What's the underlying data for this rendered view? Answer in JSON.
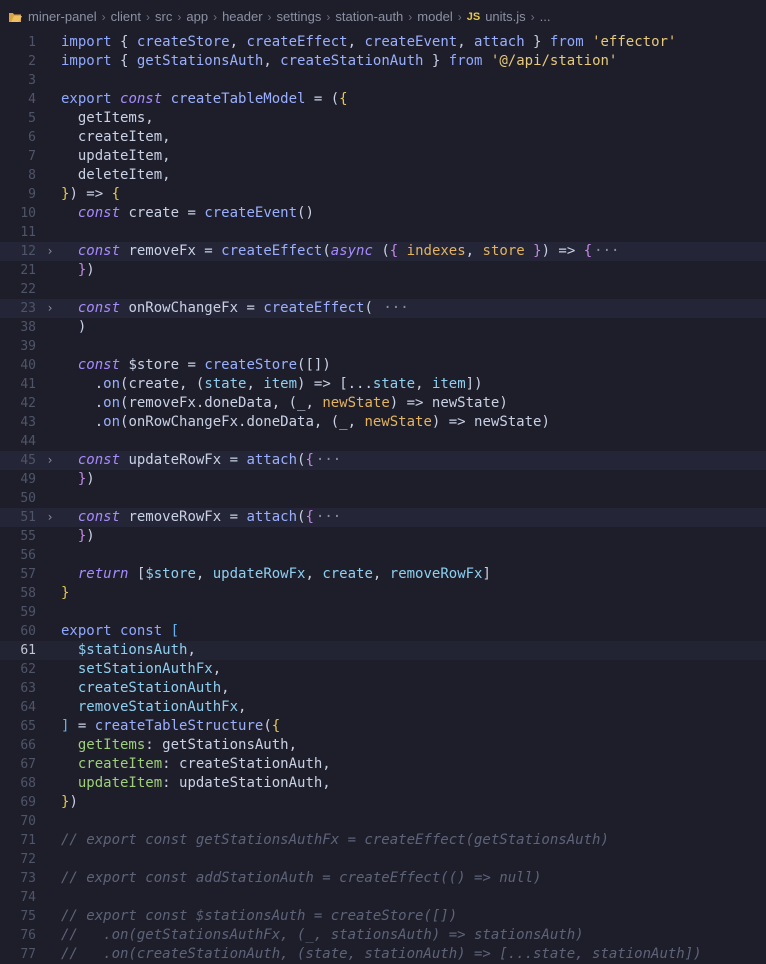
{
  "breadcrumb": {
    "items": [
      "miner-panel",
      "client",
      "src",
      "app",
      "header",
      "settings",
      "station-auth",
      "model"
    ],
    "file_badge": "JS",
    "file_name": "units.js",
    "trailing": "..."
  },
  "editor": {
    "current_line": "61",
    "lines": [
      {
        "n": "1",
        "tokens": [
          [
            "kw",
            "import "
          ],
          [
            "pun",
            "{ "
          ],
          [
            "fn",
            "createStore"
          ],
          [
            "pun",
            ", "
          ],
          [
            "fn",
            "createEffect"
          ],
          [
            "pun",
            ", "
          ],
          [
            "fn",
            "createEvent"
          ],
          [
            "pun",
            ", "
          ],
          [
            "fn",
            "attach"
          ],
          [
            "pun",
            " } "
          ],
          [
            "kw",
            "from "
          ],
          [
            "str",
            "'effector'"
          ]
        ]
      },
      {
        "n": "2",
        "tokens": [
          [
            "kw",
            "import "
          ],
          [
            "pun",
            "{ "
          ],
          [
            "fn",
            "getStationsAuth"
          ],
          [
            "pun",
            ", "
          ],
          [
            "fn",
            "createStationAuth"
          ],
          [
            "pun",
            " } "
          ],
          [
            "kw",
            "from "
          ],
          [
            "str",
            "'@/api/station'"
          ]
        ]
      },
      {
        "n": "3",
        "tokens": []
      },
      {
        "n": "4",
        "tokens": [
          [
            "kw",
            "export "
          ],
          [
            "kwi",
            "const "
          ],
          [
            "fn",
            "createTableModel"
          ],
          [
            "pun",
            " = ("
          ],
          [
            "br",
            "{"
          ]
        ]
      },
      {
        "n": "5",
        "tokens": [
          [
            "pun",
            "  "
          ],
          [
            "id",
            "getItems,"
          ]
        ]
      },
      {
        "n": "6",
        "tokens": [
          [
            "pun",
            "  "
          ],
          [
            "id",
            "createItem,"
          ]
        ]
      },
      {
        "n": "7",
        "tokens": [
          [
            "pun",
            "  "
          ],
          [
            "id",
            "updateItem,"
          ]
        ]
      },
      {
        "n": "8",
        "tokens": [
          [
            "pun",
            "  "
          ],
          [
            "id",
            "deleteItem,"
          ]
        ]
      },
      {
        "n": "9",
        "tokens": [
          [
            "br",
            "}"
          ],
          [
            "pun",
            ") => "
          ],
          [
            "br",
            "{"
          ]
        ]
      },
      {
        "n": "10",
        "tokens": [
          [
            "pun",
            "  "
          ],
          [
            "kwi",
            "const "
          ],
          [
            "id",
            "create"
          ],
          [
            "pun",
            " = "
          ],
          [
            "fn",
            "createEvent"
          ],
          [
            "pun",
            "()"
          ]
        ]
      },
      {
        "n": "11",
        "tokens": []
      },
      {
        "n": "12",
        "fold": true,
        "hl": true,
        "tokens": [
          [
            "pun",
            "  "
          ],
          [
            "kwi",
            "const "
          ],
          [
            "id",
            "removeFx"
          ],
          [
            "pun",
            " = "
          ],
          [
            "fn",
            "createEffect"
          ],
          [
            "pun",
            "("
          ],
          [
            "kwi",
            "async "
          ],
          [
            "pun",
            "("
          ],
          [
            "br2",
            "{"
          ],
          [
            "pun",
            " "
          ],
          [
            "prm",
            "indexes"
          ],
          [
            "pun",
            ", "
          ],
          [
            "prm",
            "store"
          ],
          [
            "pun",
            " "
          ],
          [
            "br2",
            "}"
          ],
          [
            "pun",
            ") => "
          ],
          [
            "br2",
            "{"
          ],
          [
            "ell",
            "···"
          ]
        ]
      },
      {
        "n": "21",
        "tokens": [
          [
            "pun",
            "  "
          ],
          [
            "br2",
            "}"
          ],
          [
            "pun",
            ")"
          ]
        ]
      },
      {
        "n": "22",
        "tokens": []
      },
      {
        "n": "23",
        "fold": true,
        "hl": true,
        "tokens": [
          [
            "pun",
            "  "
          ],
          [
            "kwi",
            "const "
          ],
          [
            "id",
            "onRowChangeFx"
          ],
          [
            "pun",
            " = "
          ],
          [
            "fn",
            "createEffect"
          ],
          [
            "pun",
            "("
          ],
          [
            "ell",
            " ···"
          ]
        ]
      },
      {
        "n": "38",
        "tokens": [
          [
            "pun",
            "  )"
          ]
        ]
      },
      {
        "n": "39",
        "tokens": []
      },
      {
        "n": "40",
        "tokens": [
          [
            "pun",
            "  "
          ],
          [
            "kwi",
            "const "
          ],
          [
            "id",
            "$store"
          ],
          [
            "pun",
            " = "
          ],
          [
            "fn",
            "createStore"
          ],
          [
            "pun",
            "([])"
          ]
        ]
      },
      {
        "n": "41",
        "tokens": [
          [
            "pun",
            "    ."
          ],
          [
            "fn",
            "on"
          ],
          [
            "pun",
            "(create, ("
          ],
          [
            "vb",
            "state"
          ],
          [
            "pun",
            ", "
          ],
          [
            "vb",
            "item"
          ],
          [
            "pun",
            ") => ["
          ],
          [
            "pun",
            "..."
          ],
          [
            "vb",
            "state"
          ],
          [
            "pun",
            ", "
          ],
          [
            "vb",
            "item"
          ],
          [
            "pun",
            "])"
          ]
        ]
      },
      {
        "n": "42",
        "tokens": [
          [
            "pun",
            "    ."
          ],
          [
            "fn",
            "on"
          ],
          [
            "pun",
            "(removeFx.doneData, (_, "
          ],
          [
            "prm",
            "newState"
          ],
          [
            "pun",
            ") => newState)"
          ]
        ]
      },
      {
        "n": "43",
        "tokens": [
          [
            "pun",
            "    ."
          ],
          [
            "fn",
            "on"
          ],
          [
            "pun",
            "(onRowChangeFx.doneData, (_, "
          ],
          [
            "prm",
            "newState"
          ],
          [
            "pun",
            ") => newState)"
          ]
        ]
      },
      {
        "n": "44",
        "tokens": []
      },
      {
        "n": "45",
        "fold": true,
        "hl": true,
        "tokens": [
          [
            "pun",
            "  "
          ],
          [
            "kwi",
            "const "
          ],
          [
            "id",
            "updateRowFx"
          ],
          [
            "pun",
            " = "
          ],
          [
            "fn",
            "attach"
          ],
          [
            "pun",
            "("
          ],
          [
            "br2",
            "{"
          ],
          [
            "ell",
            "···"
          ]
        ]
      },
      {
        "n": "49",
        "tokens": [
          [
            "pun",
            "  "
          ],
          [
            "br2",
            "}"
          ],
          [
            "pun",
            ")"
          ]
        ]
      },
      {
        "n": "50",
        "tokens": []
      },
      {
        "n": "51",
        "fold": true,
        "hl": true,
        "tokens": [
          [
            "pun",
            "  "
          ],
          [
            "kwi",
            "const "
          ],
          [
            "id",
            "removeRowFx"
          ],
          [
            "pun",
            " = "
          ],
          [
            "fn",
            "attach"
          ],
          [
            "pun",
            "("
          ],
          [
            "br2",
            "{"
          ],
          [
            "ell",
            "···"
          ]
        ]
      },
      {
        "n": "55",
        "tokens": [
          [
            "pun",
            "  "
          ],
          [
            "br2",
            "}"
          ],
          [
            "pun",
            ")"
          ]
        ]
      },
      {
        "n": "56",
        "tokens": []
      },
      {
        "n": "57",
        "tokens": [
          [
            "pun",
            "  "
          ],
          [
            "kwi",
            "return "
          ],
          [
            "pun",
            "["
          ],
          [
            "vb",
            "$store"
          ],
          [
            "pun",
            ", "
          ],
          [
            "vb",
            "updateRowFx"
          ],
          [
            "pun",
            ", "
          ],
          [
            "vb",
            "create"
          ],
          [
            "pun",
            ", "
          ],
          [
            "vb",
            "removeRowFx"
          ],
          [
            "pun",
            "]"
          ]
        ]
      },
      {
        "n": "58",
        "tokens": [
          [
            "br",
            "}"
          ]
        ]
      },
      {
        "n": "59",
        "tokens": []
      },
      {
        "n": "60",
        "tokens": [
          [
            "kw",
            "export "
          ],
          [
            "kw",
            "const "
          ],
          [
            "br3",
            "["
          ]
        ]
      },
      {
        "n": "61",
        "current": true,
        "tokens": [
          [
            "pun",
            "  "
          ],
          [
            "vb",
            "$stationsAuth"
          ],
          [
            "pun",
            ","
          ]
        ]
      },
      {
        "n": "62",
        "tokens": [
          [
            "pun",
            "  "
          ],
          [
            "vb",
            "setStationAuthFx"
          ],
          [
            "pun",
            ","
          ]
        ]
      },
      {
        "n": "63",
        "tokens": [
          [
            "pun",
            "  "
          ],
          [
            "vb",
            "createStationAuth"
          ],
          [
            "pun",
            ","
          ]
        ]
      },
      {
        "n": "64",
        "tokens": [
          [
            "pun",
            "  "
          ],
          [
            "vb",
            "removeStationAuthFx"
          ],
          [
            "pun",
            ","
          ]
        ]
      },
      {
        "n": "65",
        "tokens": [
          [
            "br3",
            "]"
          ],
          [
            "pun",
            " = "
          ],
          [
            "fn",
            "createTableStructure"
          ],
          [
            "pun",
            "("
          ],
          [
            "br",
            "{"
          ]
        ]
      },
      {
        "n": "66",
        "tokens": [
          [
            "pun",
            "  "
          ],
          [
            "prop",
            "getItems"
          ],
          [
            "pun",
            ": getStationsAuth,"
          ]
        ]
      },
      {
        "n": "67",
        "tokens": [
          [
            "pun",
            "  "
          ],
          [
            "prop",
            "createItem"
          ],
          [
            "pun",
            ": createStationAuth,"
          ]
        ]
      },
      {
        "n": "68",
        "tokens": [
          [
            "pun",
            "  "
          ],
          [
            "prop",
            "updateItem"
          ],
          [
            "pun",
            ": updateStationAuth,"
          ]
        ]
      },
      {
        "n": "69",
        "tokens": [
          [
            "br",
            "}"
          ],
          [
            "pun",
            ")"
          ]
        ]
      },
      {
        "n": "70",
        "tokens": []
      },
      {
        "n": "71",
        "tokens": [
          [
            "cmt",
            "// export const getStationsAuthFx = createEffect(getStationsAuth)"
          ]
        ]
      },
      {
        "n": "72",
        "tokens": []
      },
      {
        "n": "73",
        "tokens": [
          [
            "cmt",
            "// export const addStationAuth = createEffect(() => null)"
          ]
        ]
      },
      {
        "n": "74",
        "tokens": []
      },
      {
        "n": "75",
        "tokens": [
          [
            "cmt",
            "// export const $stationsAuth = createStore([])"
          ]
        ]
      },
      {
        "n": "76",
        "tokens": [
          [
            "cmt",
            "//   .on(getStationsAuthFx, (_, stationsAuth) => stationsAuth)"
          ]
        ]
      },
      {
        "n": "77",
        "tokens": [
          [
            "cmt",
            "//   .on(createStationAuth, (state, stationAuth) => [...state, stationAuth])"
          ]
        ]
      }
    ]
  },
  "colors": {
    "background": "#1e1e2b",
    "keyword": "#8fa8ff",
    "string": "#e6c97a",
    "comment": "#5d6378",
    "bracket_gold": "#e6c84a"
  },
  "icons": {
    "folder": "folder-icon",
    "fold_chevron": "chevron-right-icon"
  }
}
